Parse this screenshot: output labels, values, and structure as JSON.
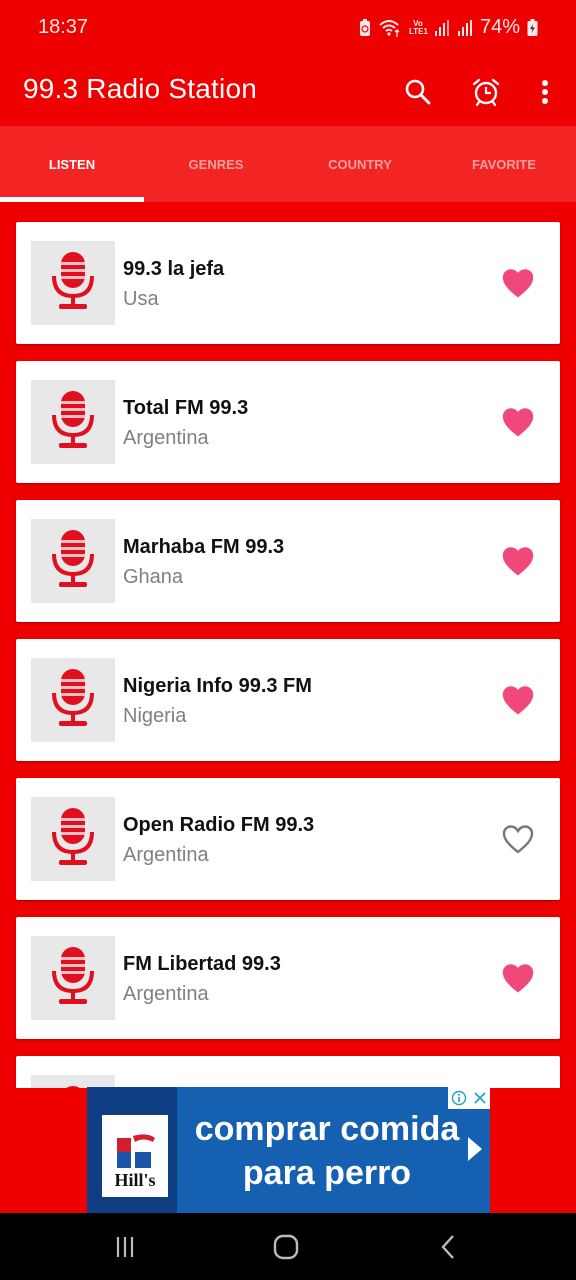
{
  "status_bar": {
    "time": "18:37",
    "network_label": "Vo LTE1",
    "battery": "74%"
  },
  "app_bar": {
    "title": "99.3 Radio Station",
    "actions": [
      "search-icon",
      "alarm-icon",
      "more-vert-icon"
    ]
  },
  "tabs": [
    {
      "label": "LISTEN",
      "active": true
    },
    {
      "label": "GENRES",
      "active": false
    },
    {
      "label": "COUNTRY",
      "active": false
    },
    {
      "label": "FAVORITE",
      "active": false
    }
  ],
  "stations": [
    {
      "name": "99.3 la jefa",
      "country": "Usa",
      "favorite": true
    },
    {
      "name": "Total FM 99.3",
      "country": "Argentina",
      "favorite": true
    },
    {
      "name": "Marhaba FM 99.3",
      "country": "Ghana",
      "favorite": true
    },
    {
      "name": "Nigeria Info 99.3 FM",
      "country": "Nigeria",
      "favorite": true
    },
    {
      "name": "Open Radio FM 99.3",
      "country": "Argentina",
      "favorite": false
    },
    {
      "name": "FM Libertad 99.3",
      "country": "Argentina",
      "favorite": true
    }
  ],
  "ad": {
    "brand": "Hill's",
    "line1": "comprar comida",
    "line2": "para perro"
  },
  "colors": {
    "primary": "#ee0000",
    "tab_bar": "#f22424",
    "mic": "#e01020",
    "heart_filled": "#f0487a",
    "heart_outline": "#777777",
    "ad_blue": "#1560b0"
  }
}
